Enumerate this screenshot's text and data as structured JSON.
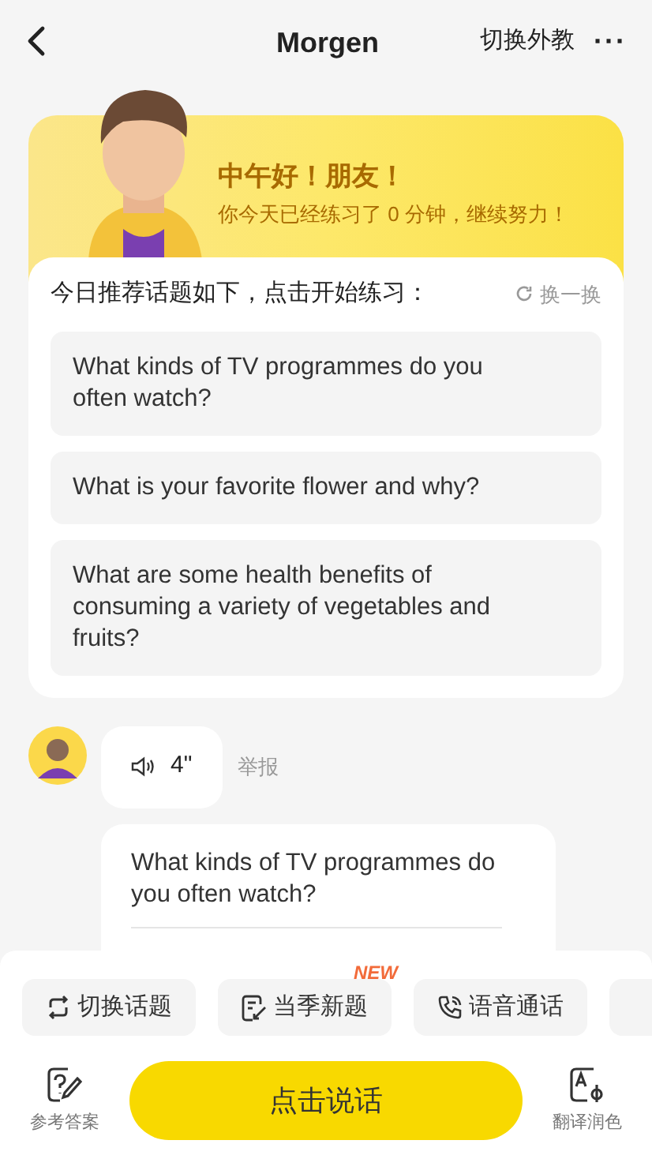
{
  "header": {
    "title": "Morgen",
    "switch_label": "切换外教",
    "more": "···"
  },
  "banner": {
    "greeting": "中午好！朋友！",
    "subtitle": "你今天已经练习了 0 分钟，继续努力！"
  },
  "topics": {
    "heading": "今日推荐话题如下，点击开始练习：",
    "refresh_label": "换一换",
    "items": [
      {
        "text": "What kinds of TV programmes do you often watch?"
      },
      {
        "text": "What is your favorite flower and why?"
      },
      {
        "text": "What are some health benefits of consuming a variety of vegetables and fruits?"
      }
    ]
  },
  "chat": {
    "voice_duration": "4\"",
    "report_label": "举报",
    "message": "What kinds of TV programmes do you often watch?"
  },
  "chips": [
    {
      "kind": "switch",
      "label": "切换话题"
    },
    {
      "kind": "new",
      "label": "当季新题",
      "badge": "NEW"
    },
    {
      "kind": "call",
      "label": "语音通话"
    },
    {
      "kind": "cut"
    }
  ],
  "bottom": {
    "left_label": "参考答案",
    "main_button": "点击说话",
    "right_label": "翻译润色"
  }
}
